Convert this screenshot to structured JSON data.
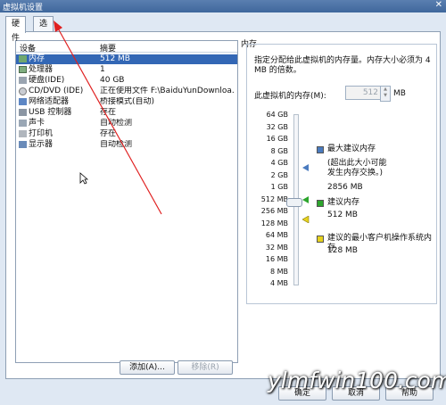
{
  "window": {
    "title": "虚拟机设置",
    "close_glyph": "✕"
  },
  "tabs": [
    {
      "label": "硬件"
    },
    {
      "label": "选项"
    }
  ],
  "devices": {
    "header": {
      "device": "设备",
      "summary": "摘要"
    },
    "items": [
      {
        "icon": "memory-icon",
        "name": "内存",
        "summary": "512 MB",
        "selected": true
      },
      {
        "icon": "cpu-icon",
        "name": "处理器",
        "summary": "1"
      },
      {
        "icon": "hard-disk-icon",
        "name": "硬盘(IDE)",
        "summary": "40 GB"
      },
      {
        "icon": "cd-dvd-icon",
        "name": "CD/DVD (IDE)",
        "summary": "正在使用文件 F:\\BaiduYunDownloa..."
      },
      {
        "icon": "network-adapter-icon",
        "name": "网络适配器",
        "summary": "桥接模式(自动)"
      },
      {
        "icon": "usb-icon",
        "name": "USB 控制器",
        "summary": "存在"
      },
      {
        "icon": "sound-card-icon",
        "name": "声卡",
        "summary": "自动检测"
      },
      {
        "icon": "printer-icon",
        "name": "打印机",
        "summary": "存在"
      },
      {
        "icon": "display-icon",
        "name": "显示器",
        "summary": "自动检测"
      }
    ],
    "add_label": "添加(A)...",
    "remove_label": "移除(R)"
  },
  "memory": {
    "group_title": "内存",
    "description": "指定分配给此虚拟机的内存量。内存大小必须为 4 MB 的倍数。",
    "field_label": "此虚拟机的内存(M):",
    "field_value": "512",
    "field_unit": "MB",
    "scale": [
      "64 GB",
      "32 GB",
      "16 GB",
      "8 GB",
      "4 GB",
      "2 GB",
      "1 GB",
      "512 MB",
      "256 MB",
      "128 MB",
      "64 MB",
      "32 MB",
      "16 MB",
      "8 MB",
      "4 MB"
    ],
    "legend": {
      "max_title": "最大建议内存",
      "max_note_1": "(超出此大小可能",
      "max_note_2": "发生内存交换。)",
      "max_value": "2856 MB",
      "rec_title": "建议内存",
      "rec_value": "512 MB",
      "min_title": "建议的最小客户机操作系统内存",
      "min_value": "128 MB"
    },
    "colors": {
      "max": "#4a7bbf",
      "rec": "#2da52d",
      "min": "#e6d21e"
    }
  },
  "footer": {
    "ok_label": "确定",
    "cancel_label": "取消",
    "help_label": "帮助"
  },
  "watermark": "ylmfwin100.com"
}
